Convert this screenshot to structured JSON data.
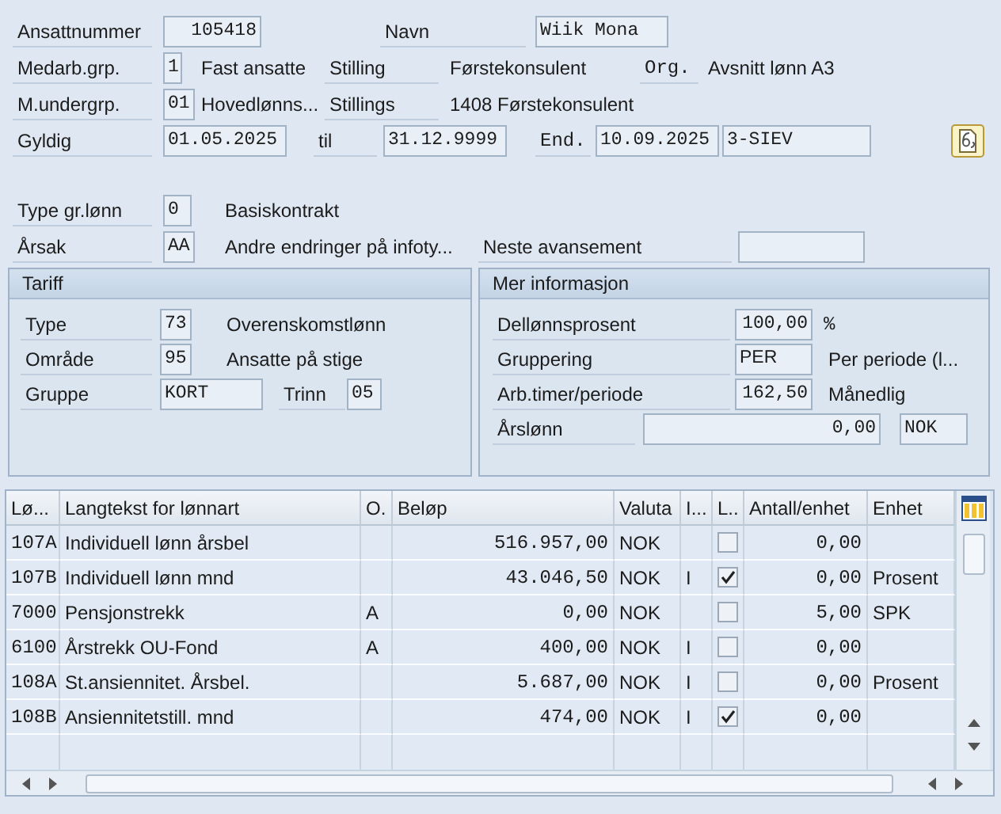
{
  "form_rows": [
    [
      {
        "kind": "label",
        "text": "Ansattnummer"
      },
      {
        "kind": "field",
        "value": "105418"
      },
      {
        "kind": "label",
        "text": "Navn"
      },
      {
        "kind": "field",
        "value": "Wiik Mona"
      }
    ],
    [
      {
        "kind": "label",
        "text": "Medarb.grp."
      },
      {
        "kind": "field",
        "value": "1"
      },
      {
        "kind": "text",
        "text": "Fast ansatte"
      },
      {
        "kind": "label",
        "text": "Stilling"
      },
      {
        "kind": "text",
        "text": "Førstekonsulent"
      },
      {
        "kind": "label",
        "text": "Org."
      },
      {
        "kind": "text",
        "text": "Avsnitt lønn A3"
      }
    ],
    [
      {
        "kind": "label",
        "text": "M.undergrp."
      },
      {
        "kind": "field",
        "value": "01"
      },
      {
        "kind": "text",
        "text": "Hovedlønns..."
      },
      {
        "kind": "label",
        "text": "Stillings"
      },
      {
        "kind": "text",
        "text": "1408 Førstekonsulent"
      }
    ],
    [
      {
        "kind": "label",
        "text": "Gyldig"
      },
      {
        "kind": "field",
        "value": "01.05.2025"
      },
      {
        "kind": "label",
        "text": "til"
      },
      {
        "kind": "field",
        "value": "31.12.9999"
      },
      {
        "kind": "label",
        "text": "End."
      },
      {
        "kind": "field",
        "value": "10.09.2025"
      },
      {
        "kind": "field",
        "value": "3-SIEV"
      }
    ],
    [
      {
        "kind": "label",
        "text": "Type gr.lønn"
      },
      {
        "kind": "field",
        "value": "0"
      },
      {
        "kind": "text",
        "text": "Basiskontrakt"
      }
    ],
    [
      {
        "kind": "label",
        "text": "Årsak"
      },
      {
        "kind": "field",
        "value": "AA"
      },
      {
        "kind": "text",
        "text": "Andre endringer på infoty..."
      },
      {
        "kind": "label",
        "text": "Neste avansement"
      },
      {
        "kind": "field"
      }
    ]
  ],
  "panels": [
    {
      "title": "Tariff",
      "rows": [
        [
          {
            "kind": "label",
            "text": "Type"
          },
          {
            "kind": "field",
            "value": "73"
          },
          {
            "kind": "text",
            "text": "Overenskomstlønn"
          }
        ],
        [
          {
            "kind": "label",
            "text": "Område"
          },
          {
            "kind": "field",
            "value": "95"
          },
          {
            "kind": "text",
            "text": "Ansatte på stige"
          }
        ],
        [
          {
            "kind": "label",
            "text": "Gruppe"
          },
          {
            "kind": "field",
            "value": "KORT"
          },
          {
            "kind": "label",
            "text": "Trinn"
          },
          {
            "kind": "field",
            "value": "05"
          }
        ]
      ]
    },
    {
      "title": "Mer informasjon",
      "rows": [
        {
          "label": "Dellønnsprosent",
          "value": "100,00",
          "note": "%"
        },
        {
          "label": "Gruppering",
          "value": "PER",
          "note": "Per periode (l..."
        },
        {
          "label": "Arb.timer/periode",
          "value": "162,50",
          "note": "Månedlig"
        },
        {
          "label": "Årslønn",
          "value": "0,00",
          "currency": "NOK"
        }
      ]
    }
  ],
  "table": {
    "columns": [
      "Lø...",
      "Langtekst for lønnart",
      "O.",
      "Beløp",
      "Valuta",
      "I...",
      "L..",
      "Antall/enhet",
      "Enhet"
    ],
    "rows": [
      {
        "wage_type": "107A",
        "text": "Individuell lønn årsbel",
        "amount": "516.957,00",
        "currency": "NOK",
        "checked": false,
        "quantity": "0,00"
      },
      {
        "wage_type": "107B",
        "text": "Individuell lønn mnd",
        "amount": "43.046,50",
        "currency": "NOK",
        "i": "I",
        "checked": true,
        "quantity": "0,00",
        "unit": "Prosent"
      },
      {
        "wage_type": "7000",
        "text": "Pensjonstrekk",
        "o": "A",
        "amount": "0,00",
        "currency": "NOK",
        "checked": false,
        "quantity": "5,00",
        "unit": "SPK"
      },
      {
        "wage_type": "6100",
        "text": "Årstrekk OU-Fond",
        "o": "A",
        "amount": "400,00",
        "currency": "NOK",
        "i": "I",
        "checked": false,
        "quantity": "0,00"
      },
      {
        "wage_type": "108A",
        "text": "St.ansiennitet. Årsbel.",
        "amount": "5.687,00",
        "currency": "NOK",
        "i": "I",
        "checked": false,
        "quantity": "0,00",
        "unit": "Prosent"
      },
      {
        "wage_type": "108B",
        "text": "Ansiennitetstill. mnd",
        "amount": "474,00",
        "currency": "NOK",
        "i": "I",
        "checked": true,
        "quantity": "0,00"
      }
    ]
  }
}
